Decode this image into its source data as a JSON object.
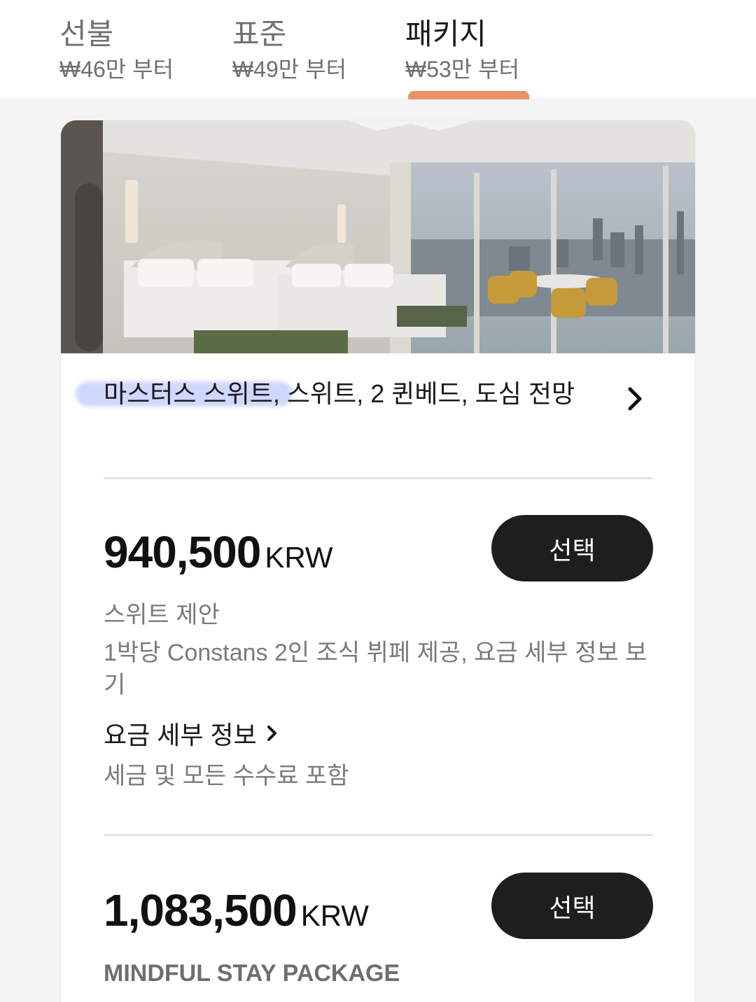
{
  "tabs": [
    {
      "title": "선불",
      "sub": "₩46만 부터"
    },
    {
      "title": "표준",
      "sub": "₩49만 부터"
    },
    {
      "title": "패키지",
      "sub": "₩53만 부터"
    }
  ],
  "active_tab": 2,
  "room": {
    "title_highlight": "마스터스 스위트",
    "title_rest": ", 스위트, 2 퀸베드, 도심 전망"
  },
  "offers": [
    {
      "price": "940,500",
      "currency": "KRW",
      "select_label": "선택",
      "category": "스위트 제안",
      "description": "1박당 Constans 2인 조식 뷔페 제공,  요금 세부 정보 보기",
      "details_link": "요금 세부 정보",
      "tax_note": "세금 및 모든 수수료 포함"
    },
    {
      "price": "1,083,500",
      "currency": "KRW",
      "select_label": "선택",
      "category": "MINDFUL STAY PACKAGE"
    }
  ],
  "colors": {
    "accent_underline": "#e8926a",
    "button_bg": "#1e1e1e",
    "highlight": "#788cff"
  }
}
